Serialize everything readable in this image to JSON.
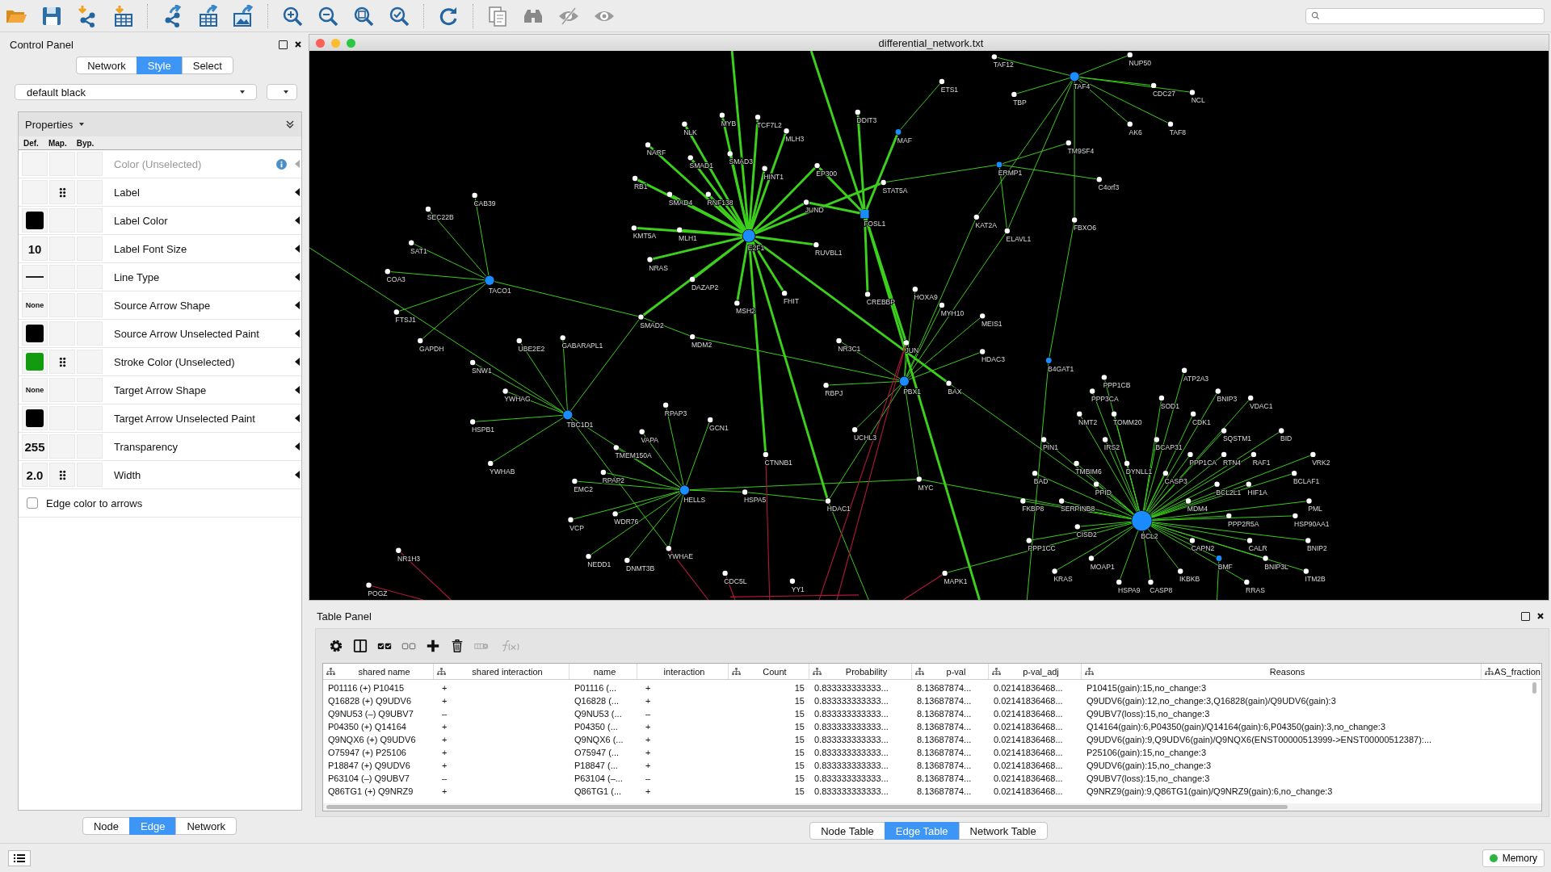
{
  "control_panel": {
    "title": "Control Panel",
    "tabs": [
      {
        "label": "Network",
        "selected": false
      },
      {
        "label": "Style",
        "selected": true
      },
      {
        "label": "Select",
        "selected": false
      }
    ],
    "style_name": "default black",
    "properties_label": "Properties",
    "columns": [
      "Def.",
      "Map.",
      "Byp."
    ],
    "properties": [
      {
        "name": "Color (Unselected)",
        "disabled": true,
        "mapped": false,
        "def": {
          "kind": "blank"
        }
      },
      {
        "name": "Label",
        "disabled": false,
        "mapped": true,
        "def": {
          "kind": "blank"
        }
      },
      {
        "name": "Label Color",
        "disabled": false,
        "mapped": false,
        "def": {
          "kind": "swatch",
          "color": "#000000"
        }
      },
      {
        "name": "Label Font Size",
        "disabled": false,
        "mapped": false,
        "def": {
          "kind": "number",
          "text": "10"
        }
      },
      {
        "name": "Line Type",
        "disabled": false,
        "mapped": false,
        "def": {
          "kind": "line"
        }
      },
      {
        "name": "Source Arrow Shape",
        "disabled": false,
        "mapped": false,
        "def": {
          "kind": "word",
          "text": "None"
        }
      },
      {
        "name": "Source Arrow Unselected Paint",
        "disabled": false,
        "mapped": false,
        "def": {
          "kind": "swatch",
          "color": "#000000"
        }
      },
      {
        "name": "Stroke Color (Unselected)",
        "disabled": false,
        "mapped": true,
        "def": {
          "kind": "swatch",
          "color": "#139b0f"
        }
      },
      {
        "name": "Target Arrow Shape",
        "disabled": false,
        "mapped": false,
        "def": {
          "kind": "word",
          "text": "None"
        }
      },
      {
        "name": "Target Arrow Unselected Paint",
        "disabled": false,
        "mapped": false,
        "def": {
          "kind": "swatch",
          "color": "#000000"
        }
      },
      {
        "name": "Transparency",
        "disabled": false,
        "mapped": false,
        "def": {
          "kind": "number",
          "text": "255"
        }
      },
      {
        "name": "Width",
        "disabled": false,
        "mapped": true,
        "def": {
          "kind": "number",
          "text": "2.0"
        }
      }
    ],
    "edge_color_to_arrows": {
      "label": "Edge color to arrows",
      "checked": false
    },
    "bottom_tabs": [
      {
        "label": "Node",
        "selected": false
      },
      {
        "label": "Edge",
        "selected": true
      },
      {
        "label": "Network",
        "selected": false
      }
    ]
  },
  "network_window": {
    "title": "differential_network.txt",
    "nodes": [
      {
        "label": "TAF12",
        "kind": "leaf"
      },
      {
        "label": "NUP50",
        "kind": "leaf"
      },
      {
        "label": "ETS1",
        "kind": "leaf"
      },
      {
        "label": "TAF4",
        "kind": "hub"
      },
      {
        "label": "CDC27",
        "kind": "leaf"
      },
      {
        "label": "TBP",
        "kind": "leaf"
      },
      {
        "label": "NCL",
        "kind": "leaf"
      },
      {
        "label": "MYB",
        "kind": "leaf"
      },
      {
        "label": "TCF7L2",
        "kind": "leaf"
      },
      {
        "label": "DDIT3",
        "kind": "leaf"
      },
      {
        "label": "NLK",
        "kind": "leaf"
      },
      {
        "label": "AK6",
        "kind": "leaf"
      },
      {
        "label": "TAF8",
        "kind": "leaf"
      },
      {
        "label": "MLH3",
        "kind": "leaf"
      },
      {
        "label": "MAF",
        "kind": "link"
      },
      {
        "label": "NARF",
        "kind": "leaf"
      },
      {
        "label": "TM9SF4",
        "kind": "leaf"
      },
      {
        "label": "SMAD1",
        "kind": "leaf"
      },
      {
        "label": "SMAD3",
        "kind": "leaf"
      },
      {
        "label": "HINT1",
        "kind": "leaf"
      },
      {
        "label": "EP300",
        "kind": "leaf"
      },
      {
        "label": "ERMP1",
        "kind": "link"
      },
      {
        "label": "RB1",
        "kind": "leaf"
      },
      {
        "label": "STAT5A",
        "kind": "leaf"
      },
      {
        "label": "C4orf3",
        "kind": "leaf"
      },
      {
        "label": "CAB39",
        "kind": "leaf"
      },
      {
        "label": "SMAD4",
        "kind": "leaf"
      },
      {
        "label": "RNF138",
        "kind": "leaf"
      },
      {
        "label": "JUND",
        "kind": "leaf"
      },
      {
        "label": "SEC22B",
        "kind": "leaf"
      },
      {
        "label": "FOSL1",
        "kind": "square"
      },
      {
        "label": "KAT2A",
        "kind": "leaf"
      },
      {
        "label": "FBXO6",
        "kind": "leaf"
      },
      {
        "label": "KMT5A",
        "kind": "leaf"
      },
      {
        "label": "MLH1",
        "kind": "leaf"
      },
      {
        "label": "ELAVL1",
        "kind": "leaf"
      },
      {
        "label": "SAT1",
        "kind": "leaf"
      },
      {
        "label": "E2F1",
        "kind": "major"
      },
      {
        "label": "RUVBL1",
        "kind": "leaf"
      },
      {
        "label": "NRAS",
        "kind": "leaf"
      },
      {
        "label": "COA3",
        "kind": "leaf"
      },
      {
        "label": "TACO1",
        "kind": "hub"
      },
      {
        "label": "DAZAP2",
        "kind": "leaf"
      },
      {
        "label": "FHIT",
        "kind": "leaf"
      },
      {
        "label": "CREBBP",
        "kind": "leaf"
      },
      {
        "label": "HOXA9",
        "kind": "leaf"
      },
      {
        "label": "MSH2",
        "kind": "leaf"
      },
      {
        "label": "MYH10",
        "kind": "leaf"
      },
      {
        "label": "FTSJ1",
        "kind": "leaf"
      },
      {
        "label": "SMAD2",
        "kind": "leaf"
      },
      {
        "label": "MEIS1",
        "kind": "leaf"
      },
      {
        "label": "GAPDH",
        "kind": "leaf"
      },
      {
        "label": "UBE2E2",
        "kind": "leaf"
      },
      {
        "label": "GABARAPL1",
        "kind": "leaf"
      },
      {
        "label": "MDM2",
        "kind": "leaf"
      },
      {
        "label": "NR3C1",
        "kind": "leaf"
      },
      {
        "label": "JUN",
        "kind": "leaf"
      },
      {
        "label": "HDAC3",
        "kind": "leaf"
      },
      {
        "label": "SNW1",
        "kind": "leaf"
      },
      {
        "label": "B4GAT1",
        "kind": "link"
      },
      {
        "label": "ATP2A3",
        "kind": "leaf"
      },
      {
        "label": "PPP1CB",
        "kind": "leaf"
      },
      {
        "label": "RBPJ",
        "kind": "leaf"
      },
      {
        "label": "PBX1",
        "kind": "hub"
      },
      {
        "label": "BAX",
        "kind": "leaf"
      },
      {
        "label": "YWHAG",
        "kind": "leaf"
      },
      {
        "label": "PPP3CA",
        "kind": "leaf"
      },
      {
        "label": "BNIP3",
        "kind": "leaf"
      },
      {
        "label": "SOD1",
        "kind": "leaf"
      },
      {
        "label": "VDAC1",
        "kind": "leaf"
      },
      {
        "label": "RPAP3",
        "kind": "leaf"
      },
      {
        "label": "HSPB1",
        "kind": "leaf"
      },
      {
        "label": "TBC1D1",
        "kind": "hub"
      },
      {
        "label": "GCN1",
        "kind": "leaf"
      },
      {
        "label": "NMT2",
        "kind": "leaf"
      },
      {
        "label": "TOMM20",
        "kind": "leaf"
      },
      {
        "label": "CDK1",
        "kind": "leaf"
      },
      {
        "label": "VAPA",
        "kind": "leaf"
      },
      {
        "label": "UCHL3",
        "kind": "leaf"
      },
      {
        "label": "SQSTM1",
        "kind": "leaf"
      },
      {
        "label": "BID",
        "kind": "leaf"
      },
      {
        "label": "PIN1",
        "kind": "leaf"
      },
      {
        "label": "IRS2",
        "kind": "leaf"
      },
      {
        "label": "BCAP31",
        "kind": "leaf"
      },
      {
        "label": "TMEM150A",
        "kind": "leaf"
      },
      {
        "label": "CTNNB1",
        "kind": "leaf"
      },
      {
        "label": "PPP1CA",
        "kind": "leaf"
      },
      {
        "label": "RTN4",
        "kind": "leaf"
      },
      {
        "label": "RAF1",
        "kind": "leaf"
      },
      {
        "label": "VRK2",
        "kind": "leaf"
      },
      {
        "label": "YWHAB",
        "kind": "leaf"
      },
      {
        "label": "TMBIM6",
        "kind": "leaf"
      },
      {
        "label": "DYNLL1",
        "kind": "leaf"
      },
      {
        "label": "RPAP2",
        "kind": "leaf"
      },
      {
        "label": "BAD",
        "kind": "leaf"
      },
      {
        "label": "CASP3",
        "kind": "leaf"
      },
      {
        "label": "BCLAF1",
        "kind": "leaf"
      },
      {
        "label": "EMC2",
        "kind": "leaf"
      },
      {
        "label": "MYC",
        "kind": "leaf"
      },
      {
        "label": "PPID",
        "kind": "leaf"
      },
      {
        "label": "BCL2L1",
        "kind": "leaf"
      },
      {
        "label": "HIF1A",
        "kind": "leaf"
      },
      {
        "label": "HELLS",
        "kind": "hub"
      },
      {
        "label": "HSPA5",
        "kind": "leaf"
      },
      {
        "label": "HDAC1",
        "kind": "leaf"
      },
      {
        "label": "FKBP8",
        "kind": "leaf"
      },
      {
        "label": "SERPINB8",
        "kind": "leaf"
      },
      {
        "label": "MDM4",
        "kind": "leaf"
      },
      {
        "label": "PML",
        "kind": "leaf"
      },
      {
        "label": "VCP",
        "kind": "leaf"
      },
      {
        "label": "WDR76",
        "kind": "leaf"
      },
      {
        "label": "PPP2R5A",
        "kind": "leaf"
      },
      {
        "label": "HSP90AA1",
        "kind": "leaf"
      },
      {
        "label": "CISD2",
        "kind": "leaf"
      },
      {
        "label": "BCL2",
        "kind": "giant"
      },
      {
        "label": "PPP1CC",
        "kind": "leaf"
      },
      {
        "label": "CAPN2",
        "kind": "leaf"
      },
      {
        "label": "CALR",
        "kind": "leaf"
      },
      {
        "label": "BNIP2",
        "kind": "leaf"
      },
      {
        "label": "NR1H3",
        "kind": "leaf"
      },
      {
        "label": "YWHAE",
        "kind": "leaf"
      },
      {
        "label": "NEDD1",
        "kind": "leaf"
      },
      {
        "label": "DNMT3B",
        "kind": "leaf"
      },
      {
        "label": "MOAP1",
        "kind": "leaf"
      },
      {
        "label": "BMF",
        "kind": "link"
      },
      {
        "label": "BNIP3L",
        "kind": "leaf"
      },
      {
        "label": "CDC5L",
        "kind": "leaf"
      },
      {
        "label": "MAPK1",
        "kind": "leaf"
      },
      {
        "label": "KRAS",
        "kind": "leaf"
      },
      {
        "label": "IKBKB",
        "kind": "leaf"
      },
      {
        "label": "ITM2B",
        "kind": "leaf"
      },
      {
        "label": "POGZ",
        "kind": "leaf"
      },
      {
        "label": "YY1",
        "kind": "leaf"
      },
      {
        "label": "HSPA9",
        "kind": "leaf"
      },
      {
        "label": "CASP8",
        "kind": "leaf"
      },
      {
        "label": "RRAS",
        "kind": "leaf"
      }
    ]
  },
  "table_panel": {
    "title": "Table Panel",
    "columns": [
      {
        "label": "shared name",
        "kind": "shared"
      },
      {
        "label": "shared interaction",
        "kind": "shared"
      },
      {
        "label": "name",
        "kind": "local"
      },
      {
        "label": "interaction",
        "kind": "local"
      },
      {
        "label": "Count",
        "kind": "shared"
      },
      {
        "label": "Probability",
        "kind": "shared"
      },
      {
        "label": "p-val",
        "kind": "shared"
      },
      {
        "label": "p-val_adj",
        "kind": "shared"
      },
      {
        "label": "Reasons",
        "kind": "shared"
      },
      {
        "label": "AS_fraction",
        "kind": "shared"
      }
    ],
    "rows": [
      [
        "P01116 (+) P10415",
        "+",
        "P01116 (...",
        "+",
        "15",
        "0.833333333333...",
        "8.13687874...",
        "0.02141836468...",
        "P10415(gain):15,no_change:3"
      ],
      [
        "Q16828 (+) Q9UDV6",
        "+",
        "Q16828 (...",
        "+",
        "15",
        "0.833333333333...",
        "8.13687874...",
        "0.02141836468...",
        "Q9UDV6(gain):12,no_change:3,Q16828(gain)/Q9UDV6(gain):3"
      ],
      [
        "Q9NU53 (–) Q9UBV7",
        "–",
        "Q9NU53 (...",
        "–",
        "15",
        "0.833333333333...",
        "8.13687874...",
        "0.02141836468...",
        "Q9UBV7(loss):15,no_change:3"
      ],
      [
        "P04350 (+) Q14164",
        "+",
        "P04350 (...",
        "+",
        "15",
        "0.833333333333...",
        "8.13687874...",
        "0.02141836468...",
        "Q14164(gain):6,P04350(gain)/Q14164(gain):6,P04350(gain):3,no_change:3"
      ],
      [
        "Q9NQX6 (+) Q9UDV6",
        "+",
        "Q9NQX6 (...",
        "+",
        "15",
        "0.833333333333...",
        "8.13687874...",
        "0.02141836468...",
        "Q9UDV6(gain):9,Q9UDV6(gain)/Q9NQX6(ENST00000513999->ENST00000512387):..."
      ],
      [
        "O75947 (+) P25106",
        "+",
        "O75947 (...",
        "+",
        "15",
        "0.833333333333...",
        "8.13687874...",
        "0.02141836468...",
        "P25106(gain):15,no_change:3"
      ],
      [
        "P18847 (+) Q9UDV6",
        "+",
        "P18847 (...",
        "+",
        "15",
        "0.833333333333...",
        "8.13687874...",
        "0.02141836468...",
        "Q9UDV6(gain):15,no_change:3"
      ],
      [
        "P63104 (–) Q9UBV7",
        "–",
        "P63104 (–...",
        "–",
        "15",
        "0.833333333333...",
        "8.13687874...",
        "0.02141836468...",
        "Q9UBV7(loss):15,no_change:3"
      ],
      [
        "Q86TG1 (+) Q9NRZ9",
        "+",
        "Q86TG1 (...",
        "+",
        "15",
        "0.833333333333...",
        "8.13687874...",
        "0.02141836468...",
        "Q9NRZ9(gain):9,Q86TG1(gain)/Q9NRZ9(gain):6,no_change:3"
      ]
    ],
    "tabs": [
      {
        "label": "Node Table",
        "selected": false
      },
      {
        "label": "Edge Table",
        "selected": true
      },
      {
        "label": "Network Table",
        "selected": false
      }
    ]
  },
  "status_bar": {
    "memory": "Memory"
  }
}
